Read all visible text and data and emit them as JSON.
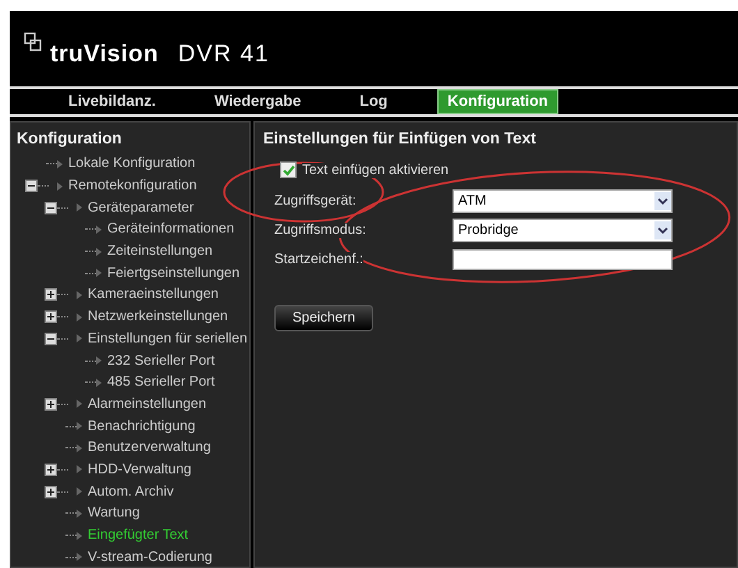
{
  "header": {
    "brand": "truVision",
    "model": "DVR 41"
  },
  "nav": [
    {
      "label": "Livebildanz.",
      "selected": false
    },
    {
      "label": "Wiedergabe",
      "selected": false
    },
    {
      "label": "Log",
      "selected": false
    },
    {
      "label": "Konfiguration",
      "selected": true
    }
  ],
  "sidebar": {
    "title": "Konfiguration",
    "items": [
      {
        "label": "Lokale Konfiguration",
        "kind": "leaf",
        "selected": false
      },
      {
        "label": "Remotekonfiguration",
        "kind": "branch",
        "expanded": true,
        "selected": false,
        "children": [
          {
            "label": "Geräteparameter",
            "kind": "branch",
            "expanded": true,
            "selected": false,
            "children": [
              {
                "label": "Geräteinformationen",
                "kind": "leaf",
                "selected": false
              },
              {
                "label": "Zeiteinstellungen",
                "kind": "leaf",
                "selected": false
              },
              {
                "label": "Feiertgseinstellungen",
                "kind": "leaf",
                "selected": false
              }
            ]
          },
          {
            "label": "Kameraeinstellungen",
            "kind": "branch",
            "expanded": false,
            "selected": false
          },
          {
            "label": "Netzwerkeinstellungen",
            "kind": "branch",
            "expanded": false,
            "selected": false
          },
          {
            "label": "Einstellungen für seriellen",
            "kind": "branch",
            "expanded": true,
            "selected": false,
            "children": [
              {
                "label": "232 Serieller Port",
                "kind": "leaf",
                "selected": false
              },
              {
                "label": "485 Serieller Port",
                "kind": "leaf",
                "selected": false
              }
            ]
          },
          {
            "label": "Alarmeinstellungen",
            "kind": "branch",
            "expanded": false,
            "selected": false
          },
          {
            "label": "Benachrichtigung",
            "kind": "leaf",
            "selected": false
          },
          {
            "label": "Benutzerverwaltung",
            "kind": "leaf",
            "selected": false
          },
          {
            "label": "HDD-Verwaltung",
            "kind": "branch",
            "expanded": false,
            "selected": false
          },
          {
            "label": "Autom. Archiv",
            "kind": "branch",
            "expanded": false,
            "selected": false
          },
          {
            "label": "Wartung",
            "kind": "leaf",
            "selected": false
          },
          {
            "label": "Eingefügter Text",
            "kind": "leaf",
            "selected": true
          },
          {
            "label": "V-stream-Codierung",
            "kind": "leaf",
            "selected": false
          }
        ]
      }
    ]
  },
  "panel": {
    "title": "Einstellungen für Einfügen von Text",
    "enable": {
      "label": "Text einfügen aktivieren",
      "checked": true
    },
    "fields": [
      {
        "label": "Zugriffsgerät:",
        "kind": "select",
        "value": "ATM"
      },
      {
        "label": "Zugriffsmodus:",
        "kind": "select",
        "value": "Probridge"
      },
      {
        "label": "Startzeichenf.:",
        "kind": "text"
      }
    ],
    "save": "Speichern"
  }
}
